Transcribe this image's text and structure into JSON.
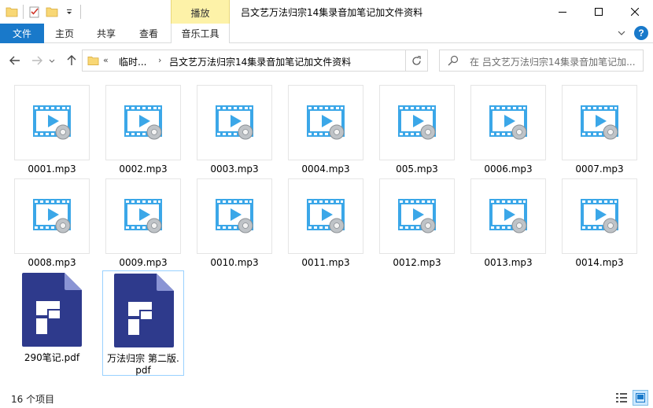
{
  "window": {
    "title": "吕文艺万法归宗14集录音加笔记加文件资料",
    "context_tab": "播放"
  },
  "ribbon": {
    "tabs": [
      "文件",
      "主页",
      "共享",
      "查看",
      "音乐工具"
    ]
  },
  "address": {
    "overflow": "«",
    "crumbs": [
      "临时...",
      "吕文艺万法归宗14集录音加笔记加文件资料"
    ]
  },
  "search": {
    "placeholder": "在 吕文艺万法归宗14集录音加笔记加..."
  },
  "files": [
    {
      "name": "0001.mp3",
      "type": "video-icon"
    },
    {
      "name": "0002.mp3",
      "type": "video-icon"
    },
    {
      "name": "0003.mp3",
      "type": "video-icon"
    },
    {
      "name": "0004.mp3",
      "type": "video-icon"
    },
    {
      "name": "005.mp3",
      "type": "video-icon"
    },
    {
      "name": "0006.mp3",
      "type": "video-icon"
    },
    {
      "name": "0007.mp3",
      "type": "video-icon"
    },
    {
      "name": "0008.mp3",
      "type": "video-icon"
    },
    {
      "name": "0009.mp3",
      "type": "video-icon"
    },
    {
      "name": "0010.mp3",
      "type": "video-icon"
    },
    {
      "name": "0011.mp3",
      "type": "video-icon"
    },
    {
      "name": "0012.mp3",
      "type": "video-icon"
    },
    {
      "name": "0013.mp3",
      "type": "video-icon"
    },
    {
      "name": "0014.mp3",
      "type": "video-icon"
    },
    {
      "name": "290笔记.pdf",
      "type": "pdf-icon"
    },
    {
      "name": "万法归宗 第二版.pdf",
      "line1": "万法归宗 第二版.",
      "line2": "pdf",
      "type": "pdf-icon",
      "selected": true
    }
  ],
  "status": {
    "count": "16 个项目"
  },
  "colors": {
    "accent": "#1979ca",
    "context_tab": "#fdf2a8",
    "video_blue": "#3ba7e8",
    "pdf_navy": "#2e3a8c",
    "selection_border": "#99d1ff"
  }
}
